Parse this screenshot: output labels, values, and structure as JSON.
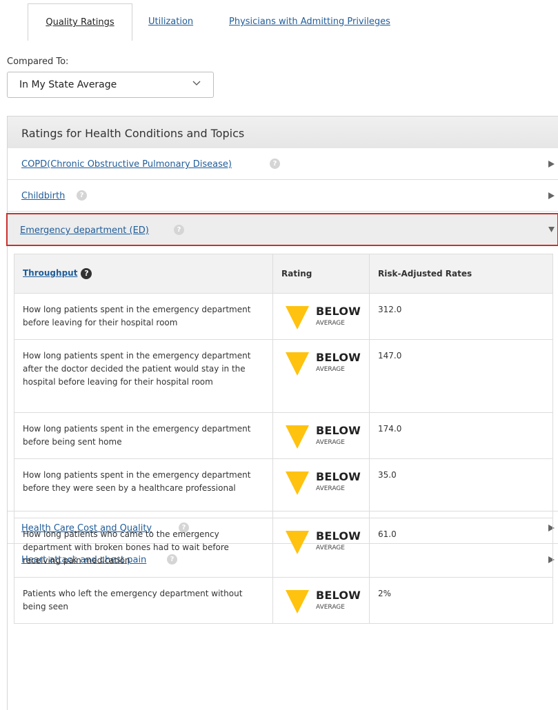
{
  "tabs": [
    {
      "label": "Quality Ratings"
    },
    {
      "label": "Utilization"
    },
    {
      "label": "Physicians with Admitting Privileges"
    }
  ],
  "compare": {
    "label": "Compared To:",
    "selected": "In My State Average"
  },
  "panel": {
    "title": "Ratings for Health Conditions and Topics",
    "rows": [
      {
        "label": "COPD(Chronic Obstructive Pulmonary Disease)"
      },
      {
        "label": "Childbirth"
      },
      {
        "label": "Emergency department (ED)"
      },
      {
        "label": "Health Care Cost and Quality"
      },
      {
        "label": "Heart attack and chest pain"
      }
    ]
  },
  "detail": {
    "headers": {
      "section": "Throughput",
      "rating": "Rating",
      "rates": "Risk-Adjusted Rates"
    },
    "measures": [
      {
        "text": "How long patients spent in the emergency department before leaving for their hospital room",
        "rating_big": "BELOW",
        "rating_small": "AVERAGE",
        "rate": "312.0"
      },
      {
        "text": "How long patients spent in the emergency department after the doctor decided the patient would stay in the hospital before leaving for their hospital room",
        "rating_big": "BELOW",
        "rating_small": "AVERAGE",
        "rate": "147.0"
      },
      {
        "text": "How long patients spent in the emergency department before being sent home",
        "rating_big": "BELOW",
        "rating_small": "AVERAGE",
        "rate": "174.0"
      },
      {
        "text": "How long patients spent in the emergency department before they were seen by a healthcare professional",
        "rating_big": "BELOW",
        "rating_small": "AVERAGE",
        "rate": "35.0"
      },
      {
        "text": "How long patients who came to the emergency department with broken bones had to wait before receiving pain medication",
        "rating_big": "BELOW",
        "rating_small": "AVERAGE",
        "rate": "61.0"
      },
      {
        "text": "Patients who left the emergency department without being seen",
        "rating_big": "BELOW",
        "rating_small": "AVERAGE",
        "rate": "2%"
      }
    ]
  },
  "colors": {
    "link": "#1f5c99",
    "rating_triangle": "#ffc20e",
    "expanded_border": "#c9302c"
  },
  "icons": {
    "help": "question-mark-circle-icon",
    "collapsed": "triangle-right-icon",
    "expanded": "triangle-down-icon",
    "select": "chevron-down-icon",
    "rating": "triangle-down-rating-icon"
  }
}
